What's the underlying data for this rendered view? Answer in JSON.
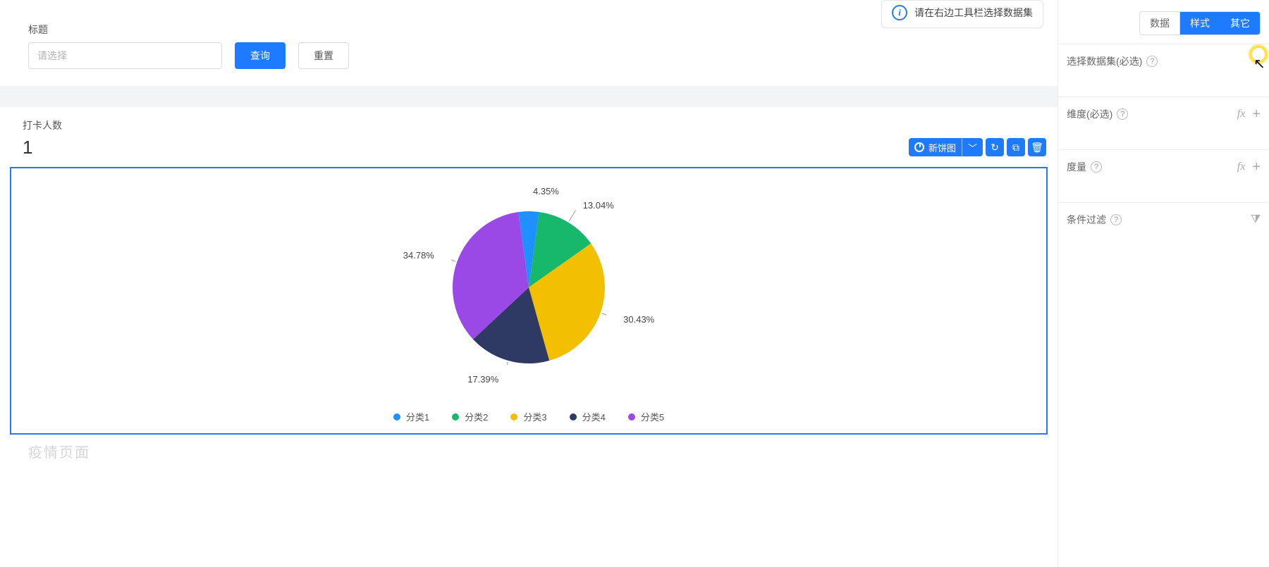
{
  "info_tip": {
    "text": "请在右边工具栏选择数据集"
  },
  "form": {
    "title_label": "标题",
    "title_placeholder": "请选择",
    "query_btn": "查询",
    "reset_btn": "重置"
  },
  "section": {
    "title": "打卡人数",
    "value": "1"
  },
  "chart_toolbar": {
    "type_label": "新饼图"
  },
  "legend_items": [
    {
      "label": "分类1",
      "color": "#1e90ff"
    },
    {
      "label": "分类2",
      "color": "#17b86c"
    },
    {
      "label": "分类3",
      "color": "#f3c000"
    },
    {
      "label": "分类4",
      "color": "#2e3a63"
    },
    {
      "label": "分类5",
      "color": "#9b49e6"
    }
  ],
  "sidebar": {
    "tabs": {
      "data": "数据",
      "style": "样式",
      "other": "其它",
      "active": "style_other"
    },
    "dataset_label": "选择数据集(必选)",
    "dimension_label": "维度(必选)",
    "measure_label": "度量",
    "filter_label": "条件过滤"
  },
  "ghost_text": "疫情页面",
  "chart_data": {
    "type": "pie",
    "title": "",
    "series": [
      {
        "name": "分类1",
        "value": 4.35,
        "color": "#1e90ff",
        "label": "4.35%"
      },
      {
        "name": "分类2",
        "value": 13.04,
        "color": "#17b86c",
        "label": "13.04%"
      },
      {
        "name": "分类3",
        "value": 30.43,
        "color": "#f3c000",
        "label": "30.43%"
      },
      {
        "name": "分类4",
        "value": 17.39,
        "color": "#2e3a63",
        "label": "17.39%"
      },
      {
        "name": "分类5",
        "value": 34.78,
        "color": "#9b49e6",
        "label": "34.78%"
      }
    ],
    "legend_position": "bottom"
  }
}
